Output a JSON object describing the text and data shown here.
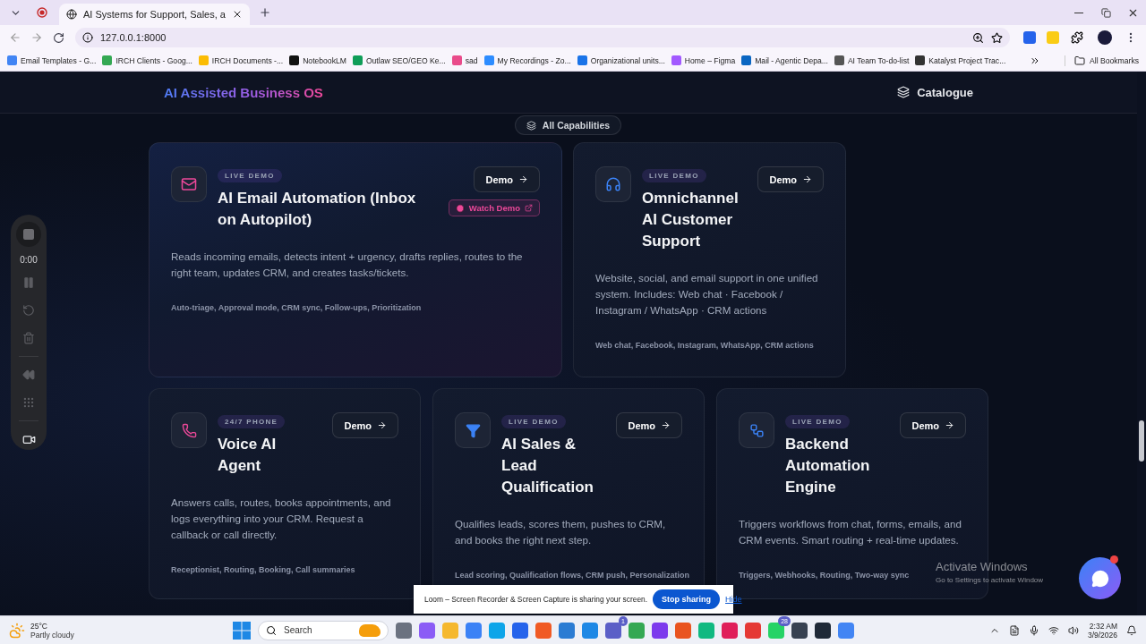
{
  "browser": {
    "tabs": [
      {
        "kind": "pinned",
        "selected": false
      },
      {
        "kind": "page",
        "title": "AI Systems for Support, Sales, a",
        "selected": true
      }
    ],
    "url": "127.0.0.1:8000",
    "bookmarks": [
      "Email Templates - G...",
      "IRCH Clients - Goog...",
      "IRCH Documents -...",
      "NotebookLM",
      "Outlaw SEO/GEO Ke...",
      "sad",
      "My Recordings - Zo...",
      "Organizational units...",
      "Home – Figma",
      "Mail - Agentic Depa...",
      "AI Team To-do-list",
      "Katalyst Project Trac..."
    ],
    "all_bookmarks": "All Bookmarks"
  },
  "page": {
    "brand": "AI Assisted Business OS",
    "nav": "Catalogue",
    "filter": "All Capabilities",
    "cards": [
      {
        "badge": "LIVE DEMO",
        "title": "AI Email Automation (Inbox on Autopilot)",
        "description": "Reads incoming emails, detects intent + urgency, drafts replies, routes to the right team, updates CRM, and creates tasks/tickets.",
        "tags": "Auto-triage, Approval mode, CRM sync, Follow-ups, Prioritization",
        "actions": [
          {
            "kind": "demo",
            "label": "Demo"
          },
          {
            "kind": "watch",
            "label": "Watch Demo"
          }
        ]
      },
      {
        "badge": "LIVE DEMO",
        "title": "Omnichannel AI Customer Support",
        "description": "Website, social, and email support in one unified system. Includes: Web chat · Facebook / Instagram / WhatsApp · CRM actions",
        "tags": "Web chat, Facebook, Instagram, WhatsApp, CRM actions",
        "actions": [
          {
            "kind": "demo",
            "label": "Demo"
          }
        ]
      },
      {
        "badge": "24/7 PHONE",
        "title": "Voice AI Agent",
        "description": "Answers calls, routes, books appointments, and logs everything into your CRM. Request a callback or call directly.",
        "tags": "Receptionist, Routing, Booking, Call summaries",
        "actions": [
          {
            "kind": "demo",
            "label": "Demo"
          }
        ]
      },
      {
        "badge": "LIVE DEMO",
        "title": "AI Sales & Lead Qualification",
        "description": "Qualifies leads, scores them, pushes to CRM, and books the right next step.",
        "tags": "Lead scoring, Qualification flows, CRM push, Personalization",
        "actions": [
          {
            "kind": "demo",
            "label": "Demo"
          }
        ]
      },
      {
        "badge": "LIVE DEMO",
        "title": "Backend Automation Engine",
        "description": "Triggers workflows from chat, forms, emails, and CRM events. Smart routing + real-time updates.",
        "tags": "Triggers, Webhooks, Routing, Two-way sync",
        "actions": [
          {
            "kind": "demo",
            "label": "Demo"
          }
        ]
      }
    ]
  },
  "recorder": {
    "timer": "0:00"
  },
  "share_bar": {
    "message": "Loom – Screen Recorder & Screen Capture is sharing your screen.",
    "stop": "Stop sharing",
    "hide": "Hide"
  },
  "watermark": {
    "title": "Activate Windows",
    "subtitle": "Go to Settings to activate Window"
  },
  "taskbar": {
    "temperature": "25°C",
    "weather": "Partly cloudy",
    "search_placeholder": "Search",
    "apps": [
      {
        "color": "#6b7280"
      },
      {
        "color": "#8b5cf6"
      },
      {
        "color": "#f5b82e"
      },
      {
        "color": "#3b82f6"
      },
      {
        "color": "#0ea5e9"
      },
      {
        "color": "#2563eb"
      },
      {
        "color": "#f05a24"
      },
      {
        "color": "#2b7cd3"
      },
      {
        "color": "#1e88e5"
      },
      {
        "color": "#5b5fc7",
        "badge": "1"
      },
      {
        "color": "#34a853"
      },
      {
        "color": "#7c3aed"
      },
      {
        "color": "#e95420"
      },
      {
        "color": "#10b981"
      },
      {
        "color": "#e01e5a"
      },
      {
        "color": "#e53935"
      },
      {
        "color": "#25d366",
        "badge": "28"
      },
      {
        "color": "#374151"
      },
      {
        "color": "#1f2937"
      },
      {
        "color": "#4285f4"
      }
    ],
    "time": "2:32 AM",
    "date": "3/9/2026"
  }
}
